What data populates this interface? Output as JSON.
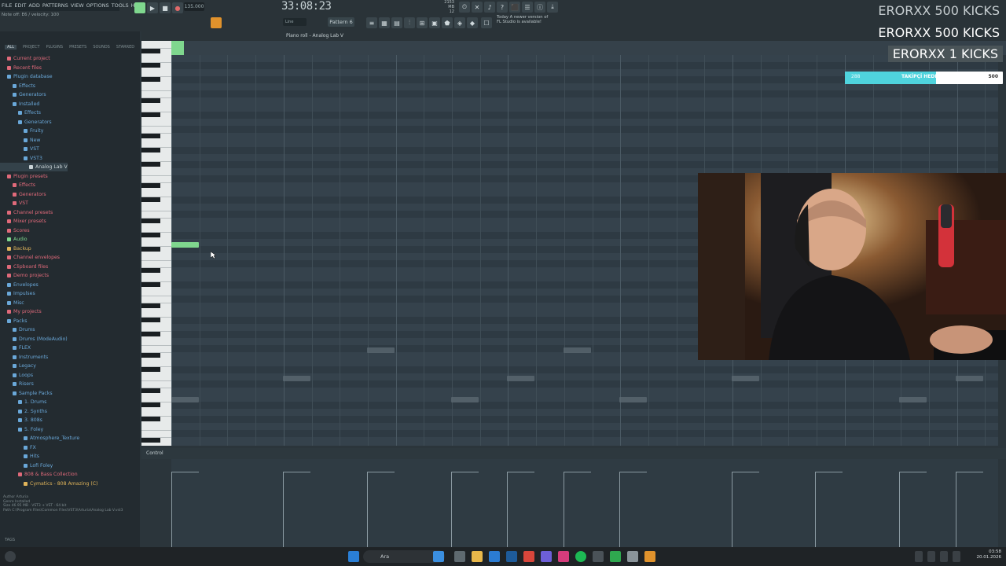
{
  "menu": [
    "FILE",
    "EDIT",
    "ADD",
    "PATTERNS",
    "VIEW",
    "OPTIONS",
    "TOOLS",
    "HELP"
  ],
  "hint": {
    "line1": "Note off: E6 / velocity: 100"
  },
  "transport": {
    "tempo": "135.000",
    "timecode": "33:08:23",
    "cpu_line1": "2153 MB",
    "cpu_line2": "12"
  },
  "toolbar": {
    "pattern": "Pattern 6",
    "snap": "Line",
    "news_line1": "Today  A newer version of",
    "news_line2": "FL Studio is available!"
  },
  "browser": {
    "tabs": [
      "ALL",
      "PROJECT",
      "PLUGINS",
      "PRESETS",
      "SOUNDS",
      "STARRED"
    ],
    "items": [
      {
        "label": "Current project",
        "indent": 1,
        "color": "#e06a7a"
      },
      {
        "label": "Recent files",
        "indent": 1,
        "color": "#e06a7a"
      },
      {
        "label": "Plugin database",
        "indent": 1,
        "color": "#6aa8d9"
      },
      {
        "label": "Effects",
        "indent": 2,
        "color": "#6aa8d9"
      },
      {
        "label": "Generators",
        "indent": 2,
        "color": "#6aa8d9"
      },
      {
        "label": "Installed",
        "indent": 2,
        "color": "#6aa8d9"
      },
      {
        "label": "Effects",
        "indent": 3,
        "color": "#6aa8d9"
      },
      {
        "label": "Generators",
        "indent": 3,
        "color": "#6aa8d9"
      },
      {
        "label": "Fruity",
        "indent": 4,
        "color": "#6aa8d9"
      },
      {
        "label": "New",
        "indent": 4,
        "color": "#6aa8d9"
      },
      {
        "label": "VST",
        "indent": 4,
        "color": "#6aa8d9"
      },
      {
        "label": "VST3",
        "indent": 4,
        "color": "#6aa8d9"
      },
      {
        "label": "Analog Lab V",
        "indent": 5,
        "color": "#c9d3d6"
      },
      {
        "label": "Plugin presets",
        "indent": 1,
        "color": "#e06a7a"
      },
      {
        "label": "Effects",
        "indent": 2,
        "color": "#e06a7a"
      },
      {
        "label": "Generators",
        "indent": 2,
        "color": "#e06a7a"
      },
      {
        "label": "VST",
        "indent": 2,
        "color": "#e06a7a"
      },
      {
        "label": "Channel presets",
        "indent": 1,
        "color": "#e06a7a"
      },
      {
        "label": "Mixer presets",
        "indent": 1,
        "color": "#e06a7a"
      },
      {
        "label": "Scores",
        "indent": 1,
        "color": "#e06a7a"
      },
      {
        "label": "Audio",
        "indent": 1,
        "color": "#7fd78e"
      },
      {
        "label": "Backup",
        "indent": 1,
        "color": "#e0b45a"
      },
      {
        "label": "Channel envelopes",
        "indent": 1,
        "color": "#e06a7a"
      },
      {
        "label": "Clipboard files",
        "indent": 1,
        "color": "#e06a7a"
      },
      {
        "label": "Demo projects",
        "indent": 1,
        "color": "#e06a7a"
      },
      {
        "label": "Envelopes",
        "indent": 1,
        "color": "#6aa8d9"
      },
      {
        "label": "Impulses",
        "indent": 1,
        "color": "#6aa8d9"
      },
      {
        "label": "Misc",
        "indent": 1,
        "color": "#6aa8d9"
      },
      {
        "label": "My projects",
        "indent": 1,
        "color": "#e06a7a"
      },
      {
        "label": "Packs",
        "indent": 1,
        "color": "#6aa8d9"
      },
      {
        "label": "Drums",
        "indent": 2,
        "color": "#6aa8d9"
      },
      {
        "label": "Drums (ModeAudio)",
        "indent": 2,
        "color": "#6aa8d9"
      },
      {
        "label": "FLEX",
        "indent": 2,
        "color": "#6aa8d9"
      },
      {
        "label": "Instruments",
        "indent": 2,
        "color": "#6aa8d9"
      },
      {
        "label": "Legacy",
        "indent": 2,
        "color": "#6aa8d9"
      },
      {
        "label": "Loops",
        "indent": 2,
        "color": "#6aa8d9"
      },
      {
        "label": "Risers",
        "indent": 2,
        "color": "#6aa8d9"
      },
      {
        "label": "Sample Packs",
        "indent": 2,
        "color": "#6aa8d9"
      },
      {
        "label": "1. Drums",
        "indent": 3,
        "color": "#6aa8d9"
      },
      {
        "label": "2. Synths",
        "indent": 3,
        "color": "#6aa8d9"
      },
      {
        "label": "3. 808s",
        "indent": 3,
        "color": "#6aa8d9"
      },
      {
        "label": "5. Foley",
        "indent": 3,
        "color": "#6aa8d9"
      },
      {
        "label": "Atmosphere_Texture",
        "indent": 4,
        "color": "#6aa8d9"
      },
      {
        "label": "FX",
        "indent": 4,
        "color": "#6aa8d9"
      },
      {
        "label": "Hits",
        "indent": 4,
        "color": "#6aa8d9"
      },
      {
        "label": "Lofi Foley",
        "indent": 4,
        "color": "#6aa8d9"
      },
      {
        "label": "808 & Bass Collection",
        "indent": 3,
        "color": "#e06a7a"
      },
      {
        "label": "Cymatics - 808 Amazing (C)",
        "indent": 4,
        "color": "#e0b45a"
      }
    ],
    "tags": "TAGS"
  },
  "piano_roll": {
    "title": "Piano roll - Analog Lab V",
    "control_label": "Control"
  },
  "overlay": {
    "line1": "ERORXX  500 KICKS",
    "line2": "ERORXX  500 KICKS",
    "line3": "ERORXX  1 KICKS"
  },
  "goal": {
    "current": "288",
    "label": "TAKİPÇİ HEDEFİ",
    "target": "500",
    "progress": 0.576
  },
  "taskbar": {
    "search_placeholder": "Ara",
    "time": "03:58",
    "date": "20.01.2026"
  },
  "colors": {
    "accent_note": "#7fd78e",
    "goal_fill": "#4fd3dd"
  }
}
